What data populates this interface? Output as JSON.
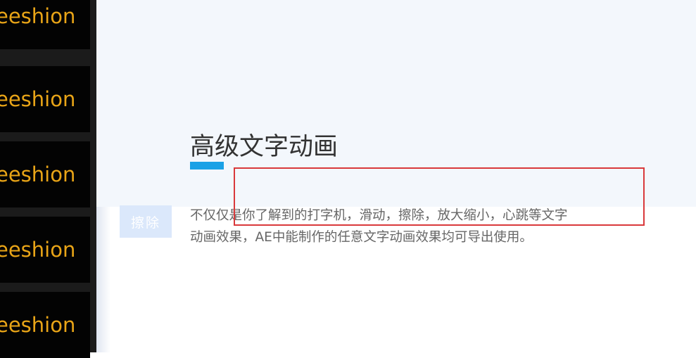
{
  "strip": {
    "frames": [
      {
        "text": "eeshion"
      },
      {
        "text": "eeshion"
      },
      {
        "text": "eeshion"
      },
      {
        "text": "eeshion"
      },
      {
        "text": "eeshion"
      }
    ],
    "text_color": "#e8a417"
  },
  "section": {
    "title": "高级文字动画",
    "tag_label": "擦除",
    "description": "不仅仅是你了解到的打字机，滑动，擦除，放大缩小，心跳等文字动画效果，AE中能制作的任意文字动画效果均可导出使用。",
    "accent_color": "#1aa1e6"
  },
  "highlight": {
    "color": "#d9393b"
  }
}
